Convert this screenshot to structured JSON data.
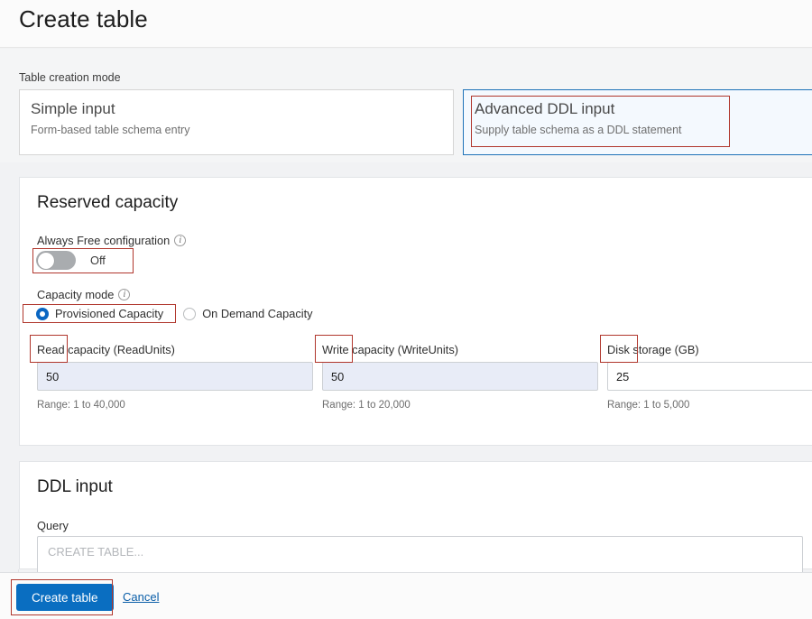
{
  "header": {
    "title": "Create table"
  },
  "mode": {
    "label": "Table creation mode",
    "tiles": [
      {
        "title": "Simple input",
        "subtitle": "Form-based table schema entry",
        "selected": false
      },
      {
        "title": "Advanced DDL input",
        "subtitle": "Supply table schema as a DDL statement",
        "selected": true
      }
    ]
  },
  "reserved_capacity": {
    "title": "Reserved capacity",
    "always_free": {
      "label": "Always Free configuration",
      "state": "Off"
    },
    "capacity_mode": {
      "label": "Capacity mode",
      "options": [
        {
          "label": "Provisioned Capacity",
          "checked": true
        },
        {
          "label": "On Demand Capacity",
          "checked": false
        }
      ]
    },
    "fields": [
      {
        "label": "Read capacity (ReadUnits)",
        "value": "50",
        "hint": "Range: 1 to 40,000"
      },
      {
        "label": "Write capacity (WriteUnits)",
        "value": "50",
        "hint": "Range: 1 to 20,000"
      },
      {
        "label": "Disk storage (GB)",
        "value": "25",
        "hint": "Range: 1 to 5,000"
      }
    ]
  },
  "ddl": {
    "title": "DDL input",
    "query_label": "Query",
    "query_placeholder": "CREATE TABLE..."
  },
  "footer": {
    "create_label": "Create table",
    "cancel_label": "Cancel"
  },
  "colors": {
    "accent": "#0a6ec1",
    "selected_border": "#1d72b8",
    "annotation": "#b0362c",
    "radio_checked": "#0a66c2",
    "input_fill": "#e8ecf7"
  }
}
